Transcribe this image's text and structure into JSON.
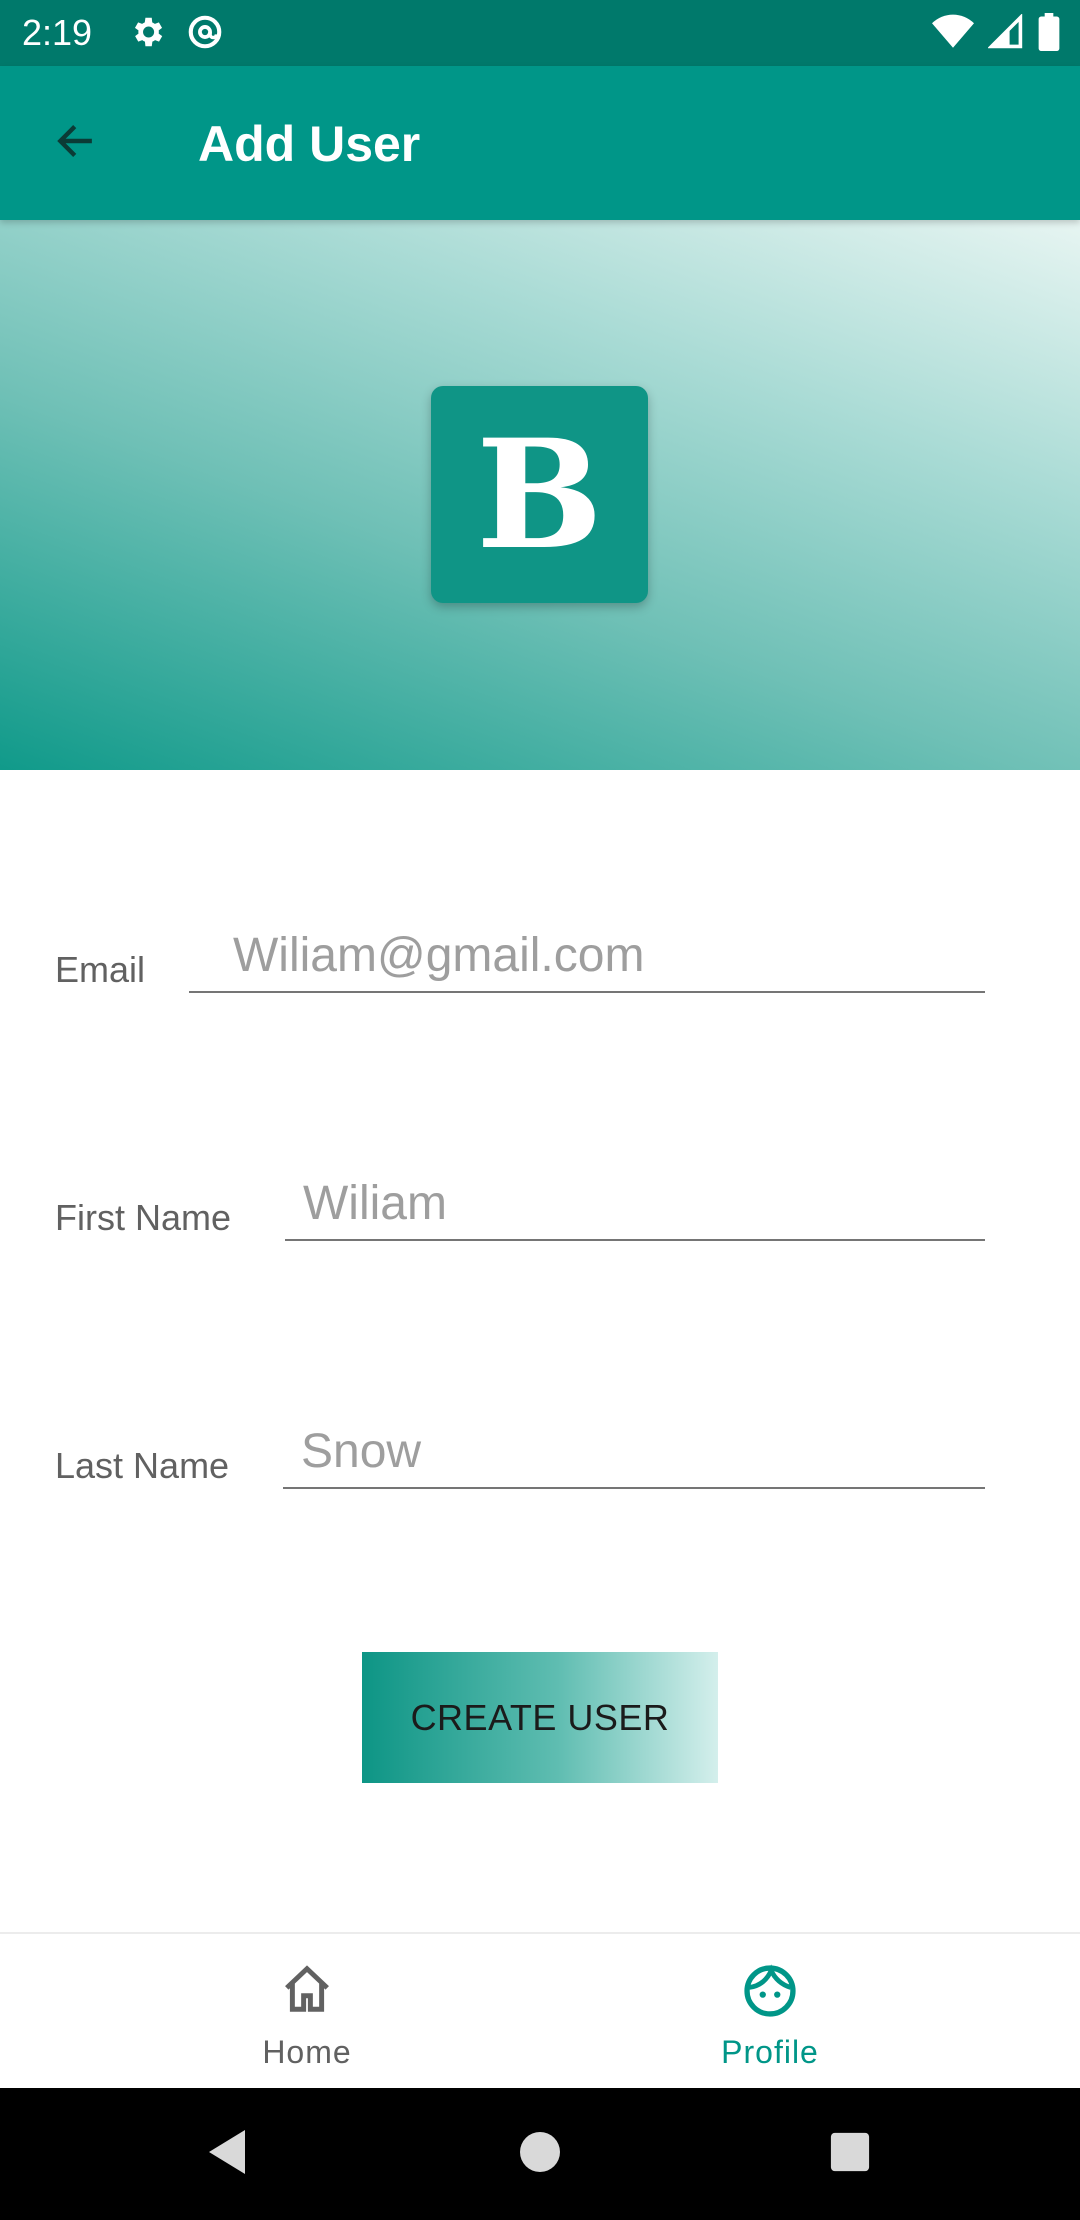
{
  "status_bar": {
    "time": "2:19"
  },
  "app_bar": {
    "title": "Add User"
  },
  "banner": {
    "logo_letter": "B"
  },
  "form": {
    "email": {
      "label": "Email",
      "placeholder": "Wiliam@gmail.com"
    },
    "first_name": {
      "label": "First Name",
      "placeholder": "Wiliam"
    },
    "last_name": {
      "label": "Last Name",
      "placeholder": "Snow"
    },
    "submit_label": "CREATE USER"
  },
  "bottom_nav": {
    "items": [
      {
        "label": "Home",
        "icon": "home-icon",
        "active": false
      },
      {
        "label": "Profile",
        "icon": "profile-face-icon",
        "active": true
      }
    ]
  },
  "colors": {
    "status_bar": "#00796b",
    "app_bar": "#009688",
    "accent": "#009688",
    "inactive_nav": "#616161"
  }
}
